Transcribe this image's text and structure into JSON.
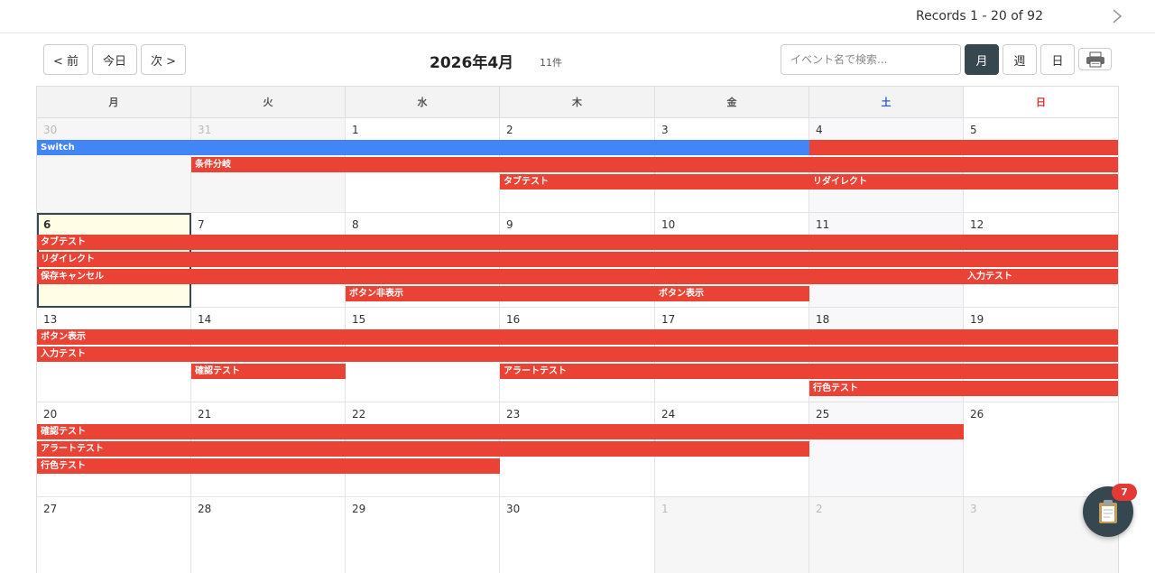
{
  "records": {
    "text": "Records 1 - 20 of 92"
  },
  "toolbar": {
    "prev_label": "< 前",
    "today_label": "今日",
    "next_label": "次 >",
    "month_title": "2026年4月",
    "count": "11件",
    "search_placeholder": "イベント名で検索...",
    "view_month": "月",
    "view_week": "週",
    "view_day": "日",
    "print_icon": "printer-icon"
  },
  "calendar": {
    "weekdays": [
      "月",
      "火",
      "水",
      "木",
      "金",
      "土",
      "日"
    ],
    "weeks": [
      [
        {
          "day": "30",
          "other": true
        },
        {
          "day": "31",
          "other": true
        },
        {
          "day": "1"
        },
        {
          "day": "2"
        },
        {
          "day": "3"
        },
        {
          "day": "4",
          "weekend": true
        },
        {
          "day": "5"
        }
      ],
      [
        {
          "day": "6",
          "today": true
        },
        {
          "day": "7"
        },
        {
          "day": "8"
        },
        {
          "day": "9"
        },
        {
          "day": "10"
        },
        {
          "day": "11",
          "weekend": true
        },
        {
          "day": "12"
        }
      ],
      [
        {
          "day": "13"
        },
        {
          "day": "14"
        },
        {
          "day": "15"
        },
        {
          "day": "16"
        },
        {
          "day": "17"
        },
        {
          "day": "18",
          "weekend": true
        },
        {
          "day": "19"
        }
      ],
      [
        {
          "day": "20"
        },
        {
          "day": "21"
        },
        {
          "day": "22"
        },
        {
          "day": "23"
        },
        {
          "day": "24"
        },
        {
          "day": "25",
          "weekend": true
        },
        {
          "day": "26"
        }
      ],
      [
        {
          "day": "27"
        },
        {
          "day": "28"
        },
        {
          "day": "29"
        },
        {
          "day": "30"
        },
        {
          "day": "1",
          "other": true
        },
        {
          "day": "2",
          "other": true
        },
        {
          "day": "3",
          "other": true
        }
      ]
    ],
    "events": [
      {
        "week": 0,
        "slot": 0,
        "start": 0,
        "end": 4,
        "title": "Switch",
        "color": "#4285f4"
      },
      {
        "week": 0,
        "slot": 0,
        "start": 5,
        "end": 6,
        "title": "",
        "color": "#ea4335"
      },
      {
        "week": 0,
        "slot": 1,
        "start": 1,
        "end": 6,
        "title": "条件分岐",
        "color": "#ea4335"
      },
      {
        "week": 0,
        "slot": 2,
        "start": 3,
        "end": 4,
        "title": "タブテスト",
        "color": "#ea4335"
      },
      {
        "week": 0,
        "slot": 2,
        "start": 5,
        "end": 6,
        "title": "リダイレクト",
        "color": "#ea4335"
      },
      {
        "week": 1,
        "slot": 0,
        "start": 0,
        "end": 6,
        "title": "タブテスト",
        "color": "#ea4335"
      },
      {
        "week": 1,
        "slot": 1,
        "start": 0,
        "end": 6,
        "title": "リダイレクト",
        "color": "#ea4335"
      },
      {
        "week": 1,
        "slot": 2,
        "start": 0,
        "end": 5,
        "title": "保存キャンセル",
        "color": "#ea4335"
      },
      {
        "week": 1,
        "slot": 2,
        "start": 6,
        "end": 6,
        "title": "入力テスト",
        "color": "#ea4335"
      },
      {
        "week": 1,
        "slot": 3,
        "start": 2,
        "end": 3,
        "title": "ボタン非表示",
        "color": "#ea4335"
      },
      {
        "week": 1,
        "slot": 3,
        "start": 4,
        "end": 4,
        "title": "ボタン表示",
        "color": "#ea4335"
      },
      {
        "week": 2,
        "slot": 0,
        "start": 0,
        "end": 6,
        "title": "ボタン表示",
        "color": "#ea4335"
      },
      {
        "week": 2,
        "slot": 1,
        "start": 0,
        "end": 6,
        "title": "入力テスト",
        "color": "#ea4335"
      },
      {
        "week": 2,
        "slot": 2,
        "start": 1,
        "end": 1,
        "title": "確認テスト",
        "color": "#ea4335"
      },
      {
        "week": 2,
        "slot": 2,
        "start": 3,
        "end": 6,
        "title": "アラートテスト",
        "color": "#ea4335"
      },
      {
        "week": 2,
        "slot": 3,
        "start": 5,
        "end": 6,
        "title": "行色テスト",
        "color": "#ea4335"
      },
      {
        "week": 3,
        "slot": 0,
        "start": 0,
        "end": 5,
        "title": "確認テスト",
        "color": "#ea4335"
      },
      {
        "week": 3,
        "slot": 1,
        "start": 0,
        "end": 4,
        "title": "アラートテスト",
        "color": "#ea4335"
      },
      {
        "week": 3,
        "slot": 2,
        "start": 0,
        "end": 2,
        "title": "行色テスト",
        "color": "#ea4335"
      }
    ]
  },
  "fab": {
    "icon": "clipboard-icon",
    "badge": "7"
  }
}
